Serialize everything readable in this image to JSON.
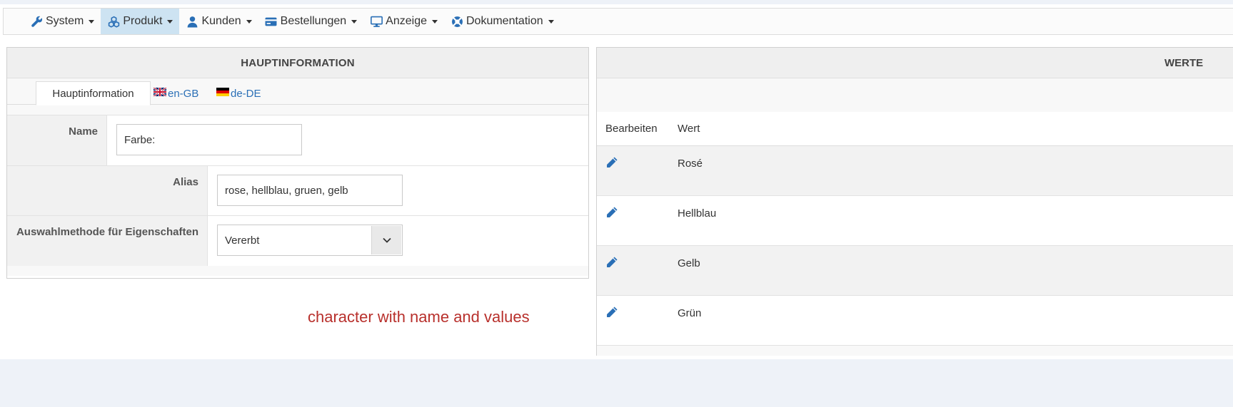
{
  "nav": {
    "items": [
      {
        "label": "System",
        "icon": "wrench-icon"
      },
      {
        "label": "Produkt",
        "icon": "cubes-icon",
        "active": true
      },
      {
        "label": "Kunden",
        "icon": "user-icon"
      },
      {
        "label": "Bestellungen",
        "icon": "credit-card-icon"
      },
      {
        "label": "Anzeige",
        "icon": "monitor-icon"
      },
      {
        "label": "Dokumentation",
        "icon": "lifebuoy-icon"
      }
    ]
  },
  "main": {
    "title": "HAUPTINFORMATION",
    "tabs": [
      {
        "label": "Hauptinformation"
      },
      {
        "label": "en-GB",
        "icon": "flag-uk-icon"
      },
      {
        "label": "de-DE",
        "icon": "flag-de-icon"
      }
    ],
    "fields": {
      "name_label": "Name",
      "name_value": "Farbe:",
      "alias_label": "Alias",
      "alias_value": "rose, hellblau, gruen, gelb",
      "method_label": "Auswahlmethode für Eigenschaften",
      "method_value": "Vererbt"
    }
  },
  "values_panel": {
    "title": "WERTE",
    "columns": {
      "edit": "Bearbeiten",
      "value": "Wert"
    },
    "rows": [
      "Rosé",
      "Hellblau",
      "Gelb",
      "Grün"
    ]
  },
  "annotation": "character with name and values",
  "colors": {
    "accent": "#2a6fb6",
    "note": "#b8302c",
    "active_nav": "#cde3f2"
  }
}
